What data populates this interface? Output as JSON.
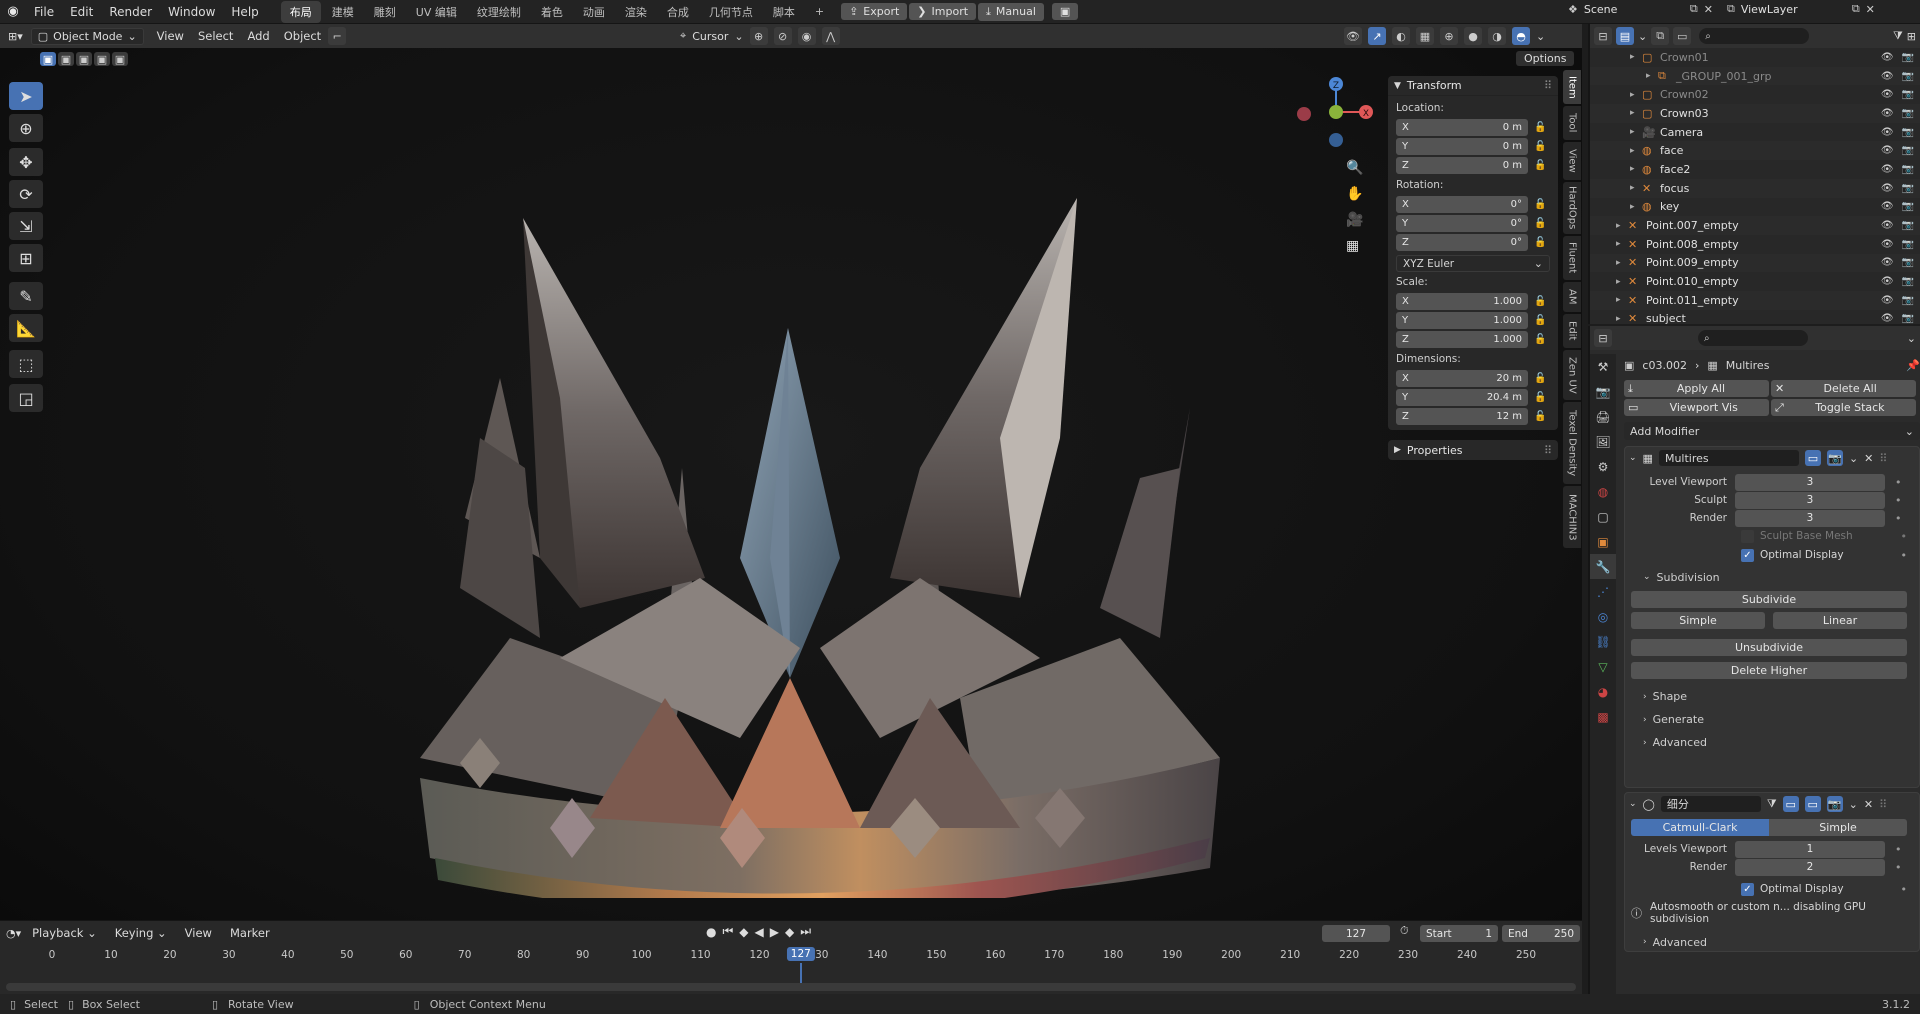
{
  "app": {
    "menu": [
      "File",
      "Edit",
      "Render",
      "Window",
      "Help"
    ],
    "workspaces": [
      "布局",
      "建模",
      "雕刻",
      "UV 编辑",
      "纹理绘制",
      "着色",
      "动画",
      "渲染",
      "合成",
      "几何节点",
      "脚本"
    ],
    "active_workspace": "布局",
    "plus": "+",
    "export_label": "Export",
    "import_label": "Import",
    "manual_label": "Manual",
    "scene_label": "Scene",
    "viewlayer_label": "ViewLayer"
  },
  "viewport_header": {
    "mode": "Object Mode",
    "menus": [
      "View",
      "Select",
      "Add",
      "Object"
    ],
    "pivot": "Cursor",
    "options_label": "Options"
  },
  "npanel": {
    "transform_title": "Transform",
    "location_label": "Location:",
    "location": [
      {
        "axis": "X",
        "value": "0 m"
      },
      {
        "axis": "Y",
        "value": "0 m"
      },
      {
        "axis": "Z",
        "value": "0 m"
      }
    ],
    "rotation_label": "Rotation:",
    "rotation": [
      {
        "axis": "X",
        "value": "0°"
      },
      {
        "axis": "Y",
        "value": "0°"
      },
      {
        "axis": "Z",
        "value": "0°"
      }
    ],
    "rotation_mode": "XYZ Euler",
    "scale_label": "Scale:",
    "scale": [
      {
        "axis": "X",
        "value": "1.000"
      },
      {
        "axis": "Y",
        "value": "1.000"
      },
      {
        "axis": "Z",
        "value": "1.000"
      }
    ],
    "dimensions_label": "Dimensions:",
    "dimensions": [
      {
        "axis": "X",
        "value": "20 m"
      },
      {
        "axis": "Y",
        "value": "20.4 m"
      },
      {
        "axis": "Z",
        "value": "12 m"
      }
    ],
    "properties_title": "Properties",
    "tabs": [
      "Item",
      "Tool",
      "View",
      "HardOps",
      "Fluent",
      "AM",
      "Edit",
      "Zen UV",
      "Texel Density",
      "MACHIN3"
    ]
  },
  "gizmo": {
    "z": "Z",
    "y": "Y",
    "x": "X"
  },
  "outliner": {
    "rows": [
      {
        "name": "Crown01",
        "dim": true
      },
      {
        "name": "_GROUP_001_grp",
        "dim": true
      },
      {
        "name": "Crown02",
        "dim": true
      },
      {
        "name": "Crown03",
        "dim": false
      },
      {
        "name": "Camera",
        "dim": false
      },
      {
        "name": "face",
        "dim": false
      },
      {
        "name": "face2",
        "dim": false
      },
      {
        "name": "focus",
        "dim": false
      },
      {
        "name": "key",
        "dim": false
      },
      {
        "name": "Point.007_empty",
        "dim": false
      },
      {
        "name": "Point.008_empty",
        "dim": false
      },
      {
        "name": "Point.009_empty",
        "dim": false
      },
      {
        "name": "Point.010_empty",
        "dim": false
      },
      {
        "name": "Point.011_empty",
        "dim": false
      },
      {
        "name": "subject",
        "dim": false
      }
    ]
  },
  "properties": {
    "object_name": "c03.002",
    "modifier_crumb": "Multires",
    "apply_all": "Apply All",
    "delete_all": "Delete All",
    "viewport_vis": "Viewport Vis",
    "toggle_stack": "Toggle Stack",
    "add_modifier": "Add Modifier",
    "multires": {
      "name": "Multires",
      "level_viewport_label": "Level Viewport",
      "level_viewport": "3",
      "sculpt_label": "Sculpt",
      "sculpt": "3",
      "render_label": "Render",
      "render": "3",
      "sculpt_base_mesh": "Sculpt Base Mesh",
      "optimal_display": "Optimal Display",
      "subdivision_title": "Subdivision",
      "subdivide": "Subdivide",
      "simple": "Simple",
      "linear": "Linear",
      "unsubdivide": "Unsubdivide",
      "delete_higher": "Delete Higher",
      "shape": "Shape",
      "generate": "Generate",
      "advanced": "Advanced"
    },
    "subsurf": {
      "name": "细分",
      "catmull": "Catmull-Clark",
      "simple": "Simple",
      "levels_viewport_label": "Levels Viewport",
      "levels_viewport": "1",
      "render_label": "Render",
      "render": "2",
      "optimal_display": "Optimal Display",
      "warning": "Autosmooth or custom n... disabling GPU subdivision",
      "advanced": "Advanced"
    }
  },
  "timeline": {
    "menus": [
      "Playback",
      "Keying",
      "View",
      "Marker"
    ],
    "current_frame": "127",
    "start_label": "Start",
    "start": "1",
    "end_label": "End",
    "end": "250",
    "ticks": [
      0,
      10,
      20,
      30,
      40,
      50,
      60,
      70,
      80,
      90,
      100,
      110,
      120,
      130,
      140,
      150,
      160,
      170,
      180,
      190,
      200,
      210,
      220,
      230,
      240,
      250
    ],
    "playhead": 127
  },
  "statusbar": {
    "select": "Select",
    "box_select": "Box Select",
    "rotate_view": "Rotate View",
    "context_menu": "Object Context Menu",
    "version": "3.1.2"
  },
  "colors": {
    "accent": "#4772b3",
    "axis_x": "#e05858",
    "axis_y": "#8ab33b",
    "axis_z": "#4c87d6"
  }
}
